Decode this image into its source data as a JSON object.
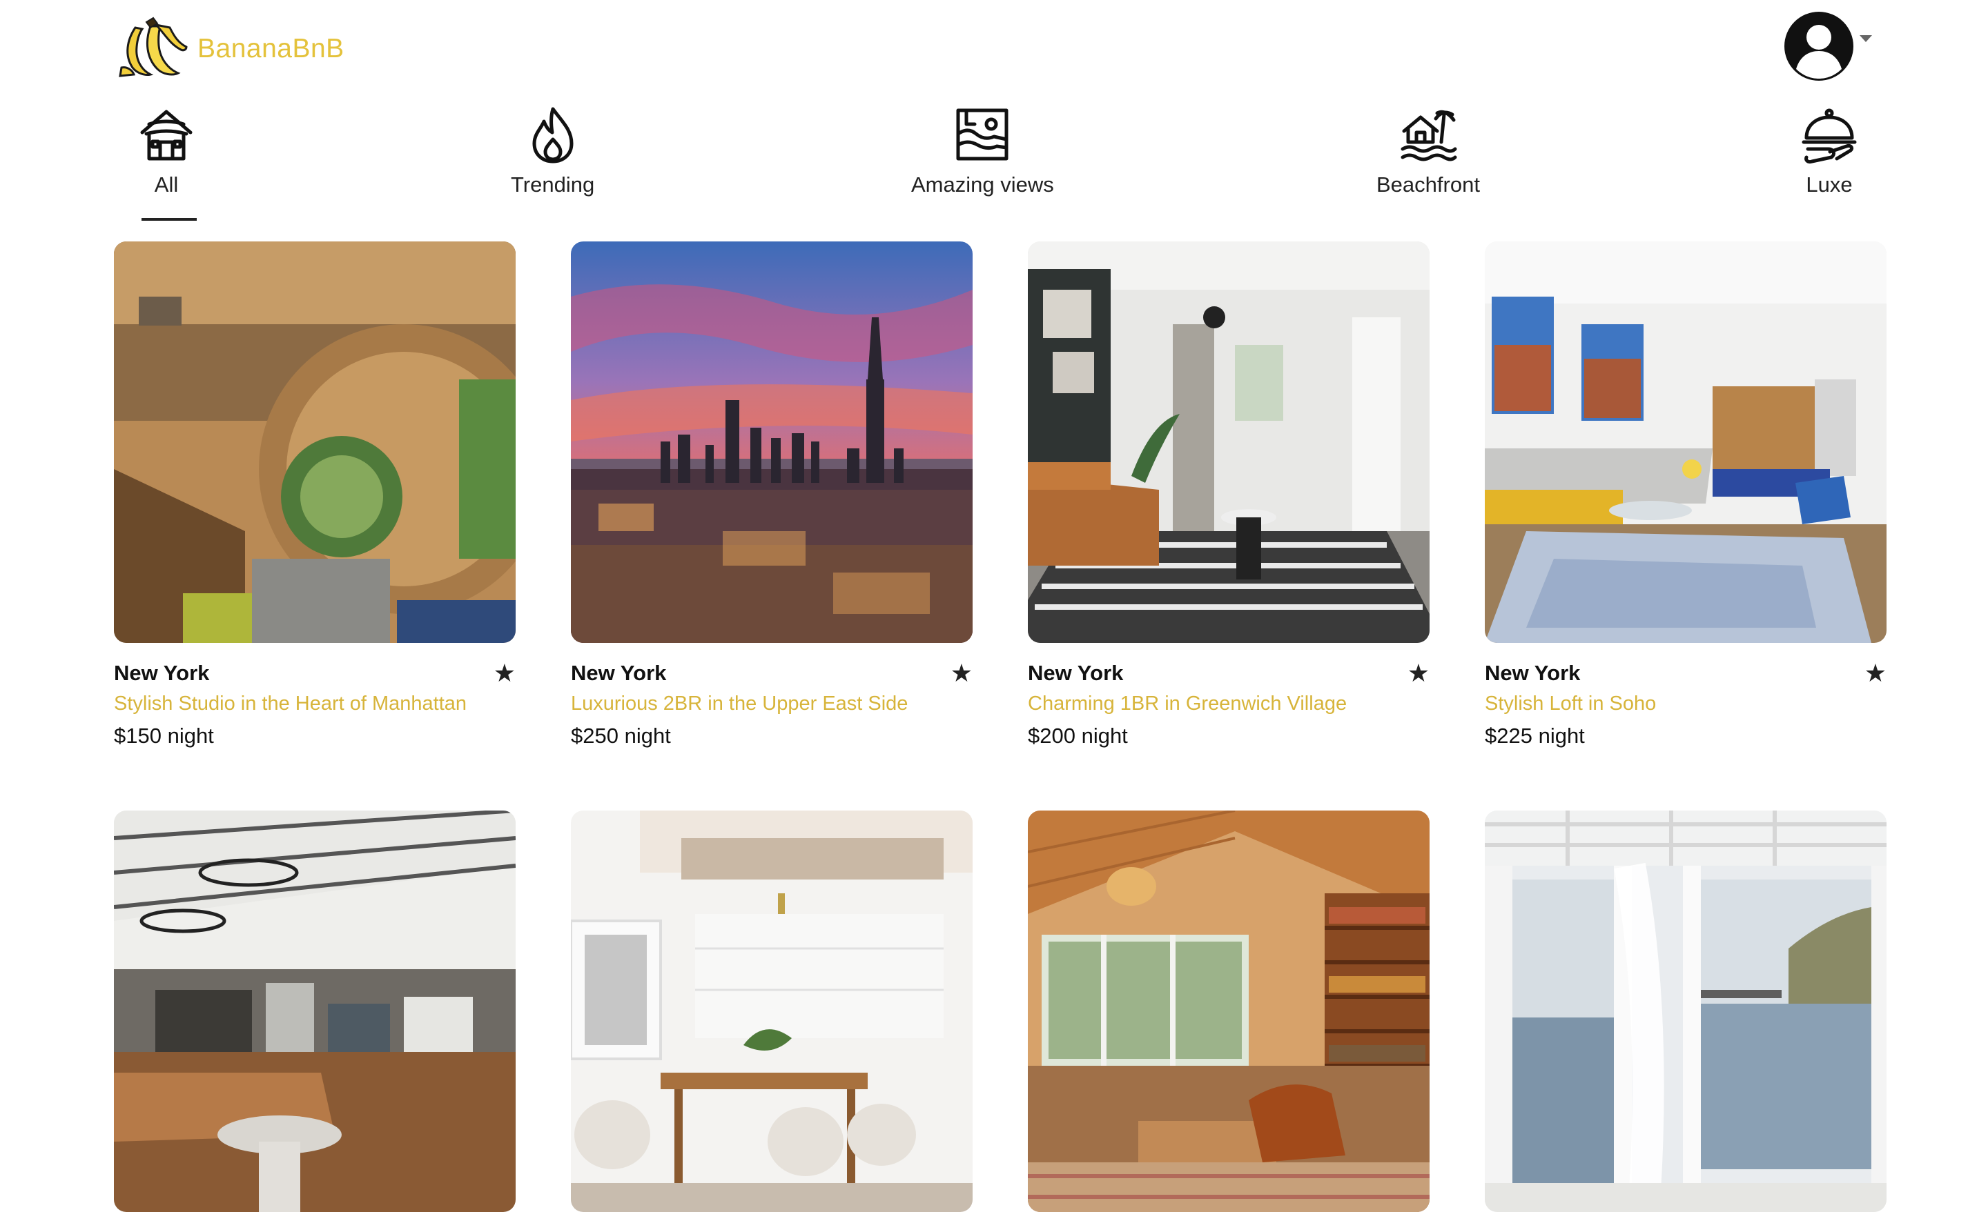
{
  "app": {
    "name": "BananaBnB"
  },
  "header": {
    "logo_text": "BananaBnB",
    "profile_icon": "user-circle-icon",
    "menu_icon": "caret-down-icon"
  },
  "categories": [
    {
      "label": "All",
      "icon": "house-icon",
      "active": true
    },
    {
      "label": "Trending",
      "icon": "flame-icon",
      "active": false
    },
    {
      "label": "Amazing views",
      "icon": "landscape-frame-icon",
      "active": false
    },
    {
      "label": "Beachfront",
      "icon": "beach-house-icon",
      "active": false
    },
    {
      "label": "Luxe",
      "icon": "cloche-icon",
      "active": false
    }
  ],
  "listings": [
    {
      "city": "New York",
      "title": "Stylish Studio in the Heart of Manhattan",
      "price": "$150 night",
      "rating_icon": "star-icon"
    },
    {
      "city": "New York",
      "title": "Luxurious 2BR in the Upper East Side",
      "price": "$250 night",
      "rating_icon": "star-icon"
    },
    {
      "city": "New York",
      "title": "Charming 1BR in Greenwich Village",
      "price": "$200 night",
      "rating_icon": "star-icon"
    },
    {
      "city": "New York",
      "title": "Stylish Loft in Soho",
      "price": "$225 night",
      "rating_icon": "star-icon"
    },
    {
      "city": "",
      "title": "",
      "price": "",
      "rating_icon": "star-icon"
    },
    {
      "city": "",
      "title": "",
      "price": "",
      "rating_icon": "star-icon"
    },
    {
      "city": "",
      "title": "",
      "price": "",
      "rating_icon": "star-icon"
    },
    {
      "city": "",
      "title": "",
      "price": "",
      "rating_icon": "star-icon"
    }
  ],
  "colors": {
    "brand": "#e4c23b",
    "title": "#d7b43a",
    "text": "#111111"
  },
  "star_glyph": "★"
}
